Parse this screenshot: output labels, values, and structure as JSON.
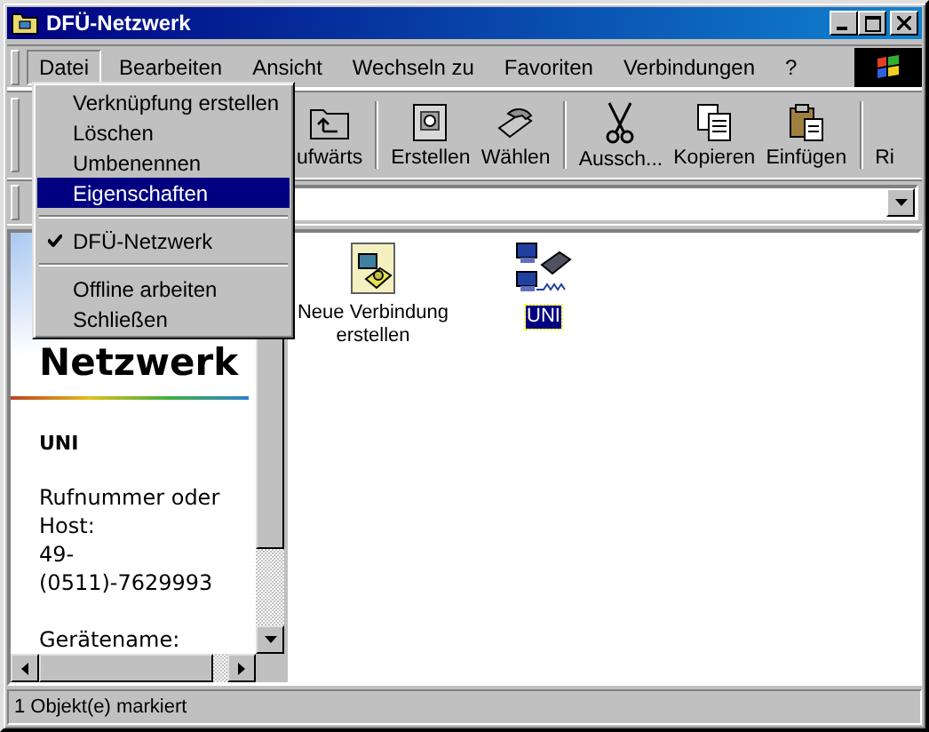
{
  "window": {
    "title": "DFÜ-Netzwerk"
  },
  "menu_bar": [
    {
      "label": "Datei",
      "selected": true
    },
    {
      "label": "Bearbeiten",
      "selected": false
    },
    {
      "label": "Ansicht",
      "selected": false
    },
    {
      "label": "Wechseln zu",
      "selected": false
    },
    {
      "label": "Favoriten",
      "selected": false
    },
    {
      "label": "Verbindungen",
      "selected": false
    },
    {
      "label": "?",
      "selected": false
    }
  ],
  "menu": [
    {
      "kind": "item",
      "label": "Verknüpfung erstellen",
      "selected": false,
      "checked": false
    },
    {
      "kind": "item",
      "label": "Löschen",
      "selected": false,
      "checked": false
    },
    {
      "kind": "item",
      "label": "Umbenennen",
      "selected": false,
      "checked": false
    },
    {
      "kind": "item",
      "label": "Eigenschaften",
      "selected": true,
      "checked": false
    },
    {
      "kind": "separator"
    },
    {
      "kind": "item",
      "label": "DFÜ-Netzwerk",
      "selected": false,
      "checked": true
    },
    {
      "kind": "separator"
    },
    {
      "kind": "item",
      "label": "Offline arbeiten",
      "selected": false,
      "checked": false
    },
    {
      "kind": "item",
      "label": "Schließen",
      "selected": false,
      "checked": false
    }
  ],
  "toolbar": [
    {
      "label": "ufwärts",
      "separator_before": false
    },
    {
      "label": "Erstellen",
      "separator_before": true
    },
    {
      "label": "Wählen",
      "separator_before": false
    },
    {
      "label": "Aussch...",
      "separator_before": true
    },
    {
      "label": "Kopieren",
      "separator_before": false
    },
    {
      "label": "Einfügen",
      "separator_before": false
    },
    {
      "label": "Ri",
      "separator_before": true
    }
  ],
  "info_pane": {
    "heading": "Netzwerk",
    "name": "UNI",
    "phone_label": "Rufnummer oder Host:",
    "phone": "49-(0511)-7629993",
    "device_label": "Gerätename:"
  },
  "items": [
    {
      "label": "Neue Verbindung erstellen",
      "selected": false
    },
    {
      "label": "UNI",
      "selected": true
    }
  ],
  "status_bar": {
    "text": "1 Objekt(e) markiert"
  }
}
